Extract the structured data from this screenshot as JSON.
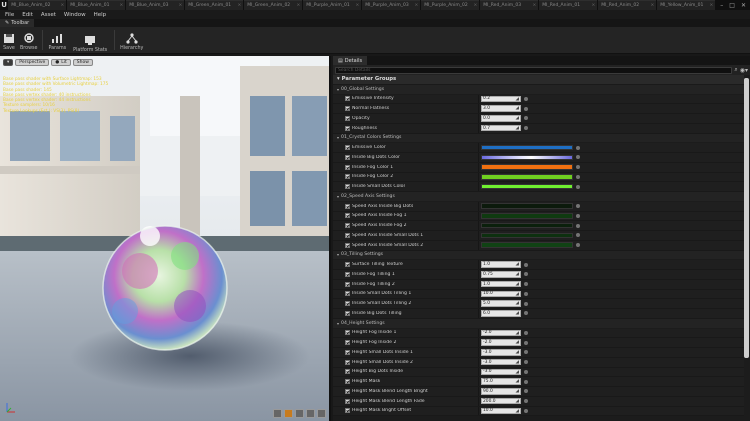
{
  "tabs": [
    "MI_Blue_Anim_02",
    "MI_Blue_Anim_01",
    "MI_Blue_Anim_03",
    "MI_Green_Anim_01",
    "MI_Green_Anim_02",
    "MI_Purple_Anim_01",
    "MI_Purple_Anim_03",
    "MI_Purple_Anim_02",
    "MI_Red_Anim_03",
    "MI_Red_Anim_01",
    "MI_Red_Anim_02",
    "MI_Yellow_Anim_01"
  ],
  "menu": [
    "File",
    "Edit",
    "Asset",
    "Window",
    "Help"
  ],
  "toolbar_tab": "Toolbar",
  "toolbar": {
    "save": "Save",
    "browse": "Browse",
    "params": "Params",
    "platform_stats": "Platform Stats",
    "hierarchy": "Hierarchy"
  },
  "viewport": {
    "perspective": "Perspective",
    "lit": "Lit",
    "show": "Show",
    "stats": [
      "Base pass shader with Surface Lightmap: 153",
      "Base pass shader with Volumetric Lightmap: 175",
      "Base pass shader: 145",
      "Base pass vertex shader: 40 instructions",
      "Base pass vertex shader: 44 instructions",
      "Texture samplers: 10/16",
      "Texture Lookups (Est.): VS(3), PS(8)"
    ]
  },
  "details": {
    "tab": "Details",
    "search_placeholder": "Search Details",
    "groups_title": "Parameter Groups",
    "sections": [
      {
        "title": "00_Global Settings",
        "props": [
          {
            "label": "Emissive Intensity",
            "type": "num",
            "value": "0.2"
          },
          {
            "label": "Normal Flatness",
            "type": "num",
            "value": "3.0"
          },
          {
            "label": "Opacity",
            "type": "num",
            "value": "0.0"
          },
          {
            "label": "Roughness",
            "type": "num",
            "value": "0.7"
          }
        ]
      },
      {
        "title": "01_Crystal Colors Settings",
        "props": [
          {
            "label": "Emissive Color",
            "type": "color",
            "value": "#1f6fc4"
          },
          {
            "label": "Inside Big Dots Color",
            "type": "color",
            "value": "#eaeaff"
          },
          {
            "label": "Inside Fog Color 1",
            "type": "color",
            "value": "#f07010"
          },
          {
            "label": "Inside Fog Color 2",
            "type": "color",
            "value": "#6fd020"
          },
          {
            "label": "Inside Small Dots Color",
            "type": "color",
            "value": "#70f030"
          }
        ]
      },
      {
        "title": "02_Speed Axis Settings",
        "props": [
          {
            "label": "Speed Axis Inside Big Dots",
            "type": "color",
            "value": "#0c1a0c"
          },
          {
            "label": "Speed Axis Inside Fog 1",
            "type": "color",
            "value": "#0f3a10"
          },
          {
            "label": "Speed Axis Inside Fog 2",
            "type": "color",
            "value": "#0b200c"
          },
          {
            "label": "Speed Axis Inside Small Dots 1",
            "type": "color",
            "value": "#0d300f"
          },
          {
            "label": "Speed Axis Inside Small Dots 2",
            "type": "color",
            "value": "#104214"
          }
        ]
      },
      {
        "title": "03_Tilling Settings",
        "props": [
          {
            "label": "Surface Tilling Texture",
            "type": "num",
            "value": "1.0"
          },
          {
            "label": "Inside Fog Tilling 1",
            "type": "num",
            "value": "0.75"
          },
          {
            "label": "Inside Fog Tilling 2",
            "type": "num",
            "value": "1.0"
          },
          {
            "label": "Inside Small Dots Tilling 1",
            "type": "num",
            "value": "10.0"
          },
          {
            "label": "Inside Small Dots Tilling 2",
            "type": "num",
            "value": "5.0"
          },
          {
            "label": "Inside Big Dots Tilling",
            "type": "num",
            "value": "6.0"
          }
        ]
      },
      {
        "title": "04_Height Settings",
        "props": [
          {
            "label": "Height Fog Inside 1",
            "type": "num",
            "value": "-2.0"
          },
          {
            "label": "Height Fog Inside 2",
            "type": "num",
            "value": "-2.0"
          },
          {
            "label": "Height Small Dots Inside 1",
            "type": "num",
            "value": "-3.0"
          },
          {
            "label": "Height Small Dots Inside 2",
            "type": "num",
            "value": "-3.0"
          },
          {
            "label": "Height Big Dots Inside",
            "type": "num",
            "value": "-3.0"
          },
          {
            "label": "Height Mask",
            "type": "num",
            "value": "75.0"
          },
          {
            "label": "Height Mask Blend Length Bright",
            "type": "num",
            "value": "90.0"
          },
          {
            "label": "Height Mask Blend Length Fade",
            "type": "num",
            "value": "200.0"
          },
          {
            "label": "Height Mask Bright Offset",
            "type": "num",
            "value": "10.0"
          }
        ]
      }
    ]
  }
}
